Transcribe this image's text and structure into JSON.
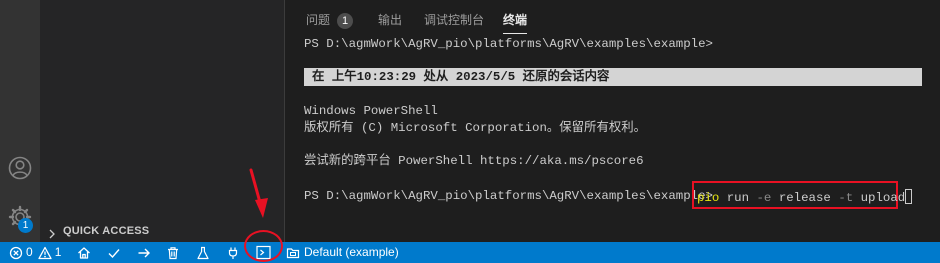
{
  "sidebar": {
    "quick_access_label": "QUICK ACCESS"
  },
  "activity_bar": {
    "settings_badge": "1"
  },
  "panel": {
    "tabs": [
      {
        "label": "问题",
        "count": "1"
      },
      {
        "label": "输出"
      },
      {
        "label": "调试控制台"
      },
      {
        "label": "终端"
      }
    ]
  },
  "terminal": {
    "lines": [
      "PS D:\\agmWork\\AgRV_pio\\platforms\\AgRV\\examples\\example>",
      "Windows PowerShell",
      "版权所有 (C) Microsoft Corporation。保留所有权利。",
      "尝试新的跨平台 PowerShell https://aka.ms/pscore6",
      "PS D:\\agmWork\\AgRV_pio\\platforms\\AgRV\\examples\\example>"
    ],
    "restore_notice": "在 上午10:23:29 处从 2023/5/5 还原的会话内容",
    "command": {
      "program": "pio",
      "sub": "run",
      "flag_e": "-e",
      "env": "release",
      "flag_t": "-t",
      "target": "upload"
    }
  },
  "status_bar": {
    "errors": "0",
    "warnings": "1",
    "env_label": "Default (example)"
  },
  "colors": {
    "status_bar": "#007acc",
    "highlight": "#e81123",
    "pio_command": "#e5e510"
  }
}
